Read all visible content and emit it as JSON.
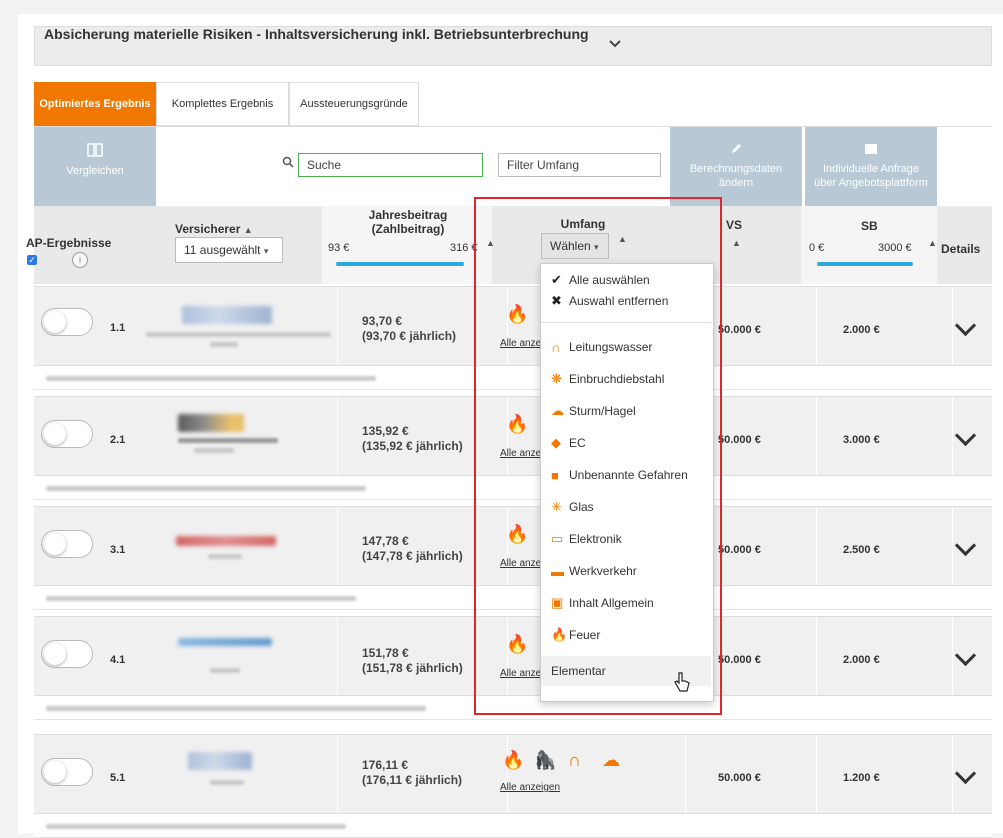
{
  "header": {
    "title": "Absicherung materielle Risiken - Inhaltsversicherung inkl. Betriebsunterbrechung",
    "chevron_icon": "chevron-down-icon"
  },
  "tabs": [
    {
      "label": "Optimiertes Ergebnis",
      "active": true
    },
    {
      "label": "Komplettes Ergebnis",
      "active": false
    },
    {
      "label": "Aussteuerungsgründe",
      "active": false
    }
  ],
  "toolbar": {
    "compare_label": "Vergleichen",
    "search_placeholder": "Suche",
    "filter_placeholder": "Filter Umfang",
    "calc_label_1": "Berechnungsdaten",
    "calc_label_2": "ändern",
    "request_label_1": "Individuelle Anfrage",
    "request_label_2": "über Angebotsplattform"
  },
  "columns": {
    "ap": "AP-Ergebnisse",
    "insurer": "Versicherer",
    "insurer_select": "11 ausgewählt",
    "premium_1": "Jahresbeitrag",
    "premium_2": "(Zahlbeitrag)",
    "premium_min": "93 €",
    "premium_max": "316 €",
    "scope": "Umfang",
    "scope_select": "Wählen",
    "vs": "VS",
    "sb": "SB",
    "sb_min": "0 €",
    "sb_max": "3000 €",
    "details": "Details"
  },
  "rows": [
    {
      "rank": "1.1",
      "price": "93,70 €",
      "yearly": "(93,70 € jährlich)",
      "show_all": "Alle anzeigen",
      "vs": "50.000 €",
      "sb": "2.000 €"
    },
    {
      "rank": "2.1",
      "price": "135,92 €",
      "yearly": "(135,92 € jährlich)",
      "show_all": "Alle anzeigen",
      "vs": "50.000 €",
      "sb": "3.000 €"
    },
    {
      "rank": "3.1",
      "price": "147,78 €",
      "yearly": "(147,78 € jährlich)",
      "show_all": "Alle anzeigen",
      "vs": "50.000 €",
      "sb": "2.500 €"
    },
    {
      "rank": "4.1",
      "price": "151,78 €",
      "yearly": "(151,78 € jährlich)",
      "show_all": "Alle anzeigen",
      "vs": "50.000 €",
      "sb": "2.000 €"
    },
    {
      "rank": "5.1",
      "price": "176,11 €",
      "yearly": "(176,11 € jährlich)",
      "show_all": "Alle anzeigen",
      "vs": "50.000 €",
      "sb": "1.200 €"
    }
  ],
  "dropdown": {
    "select_all": "Alle auswählen",
    "clear": "Auswahl entfernen",
    "items": [
      "Leitungswasser",
      "Einbruchdiebstahl",
      "Sturm/Hagel",
      "EC",
      "Unbenannte Gefahren",
      "Glas",
      "Elektronik",
      "Werkverkehr",
      "Inhalt Allgemein",
      "Feuer",
      "Elementar"
    ]
  },
  "colors": {
    "accent": "#f07800",
    "tile": "#b8c8d4",
    "highlight": "#e0262b",
    "slider": "#29a8e0"
  }
}
